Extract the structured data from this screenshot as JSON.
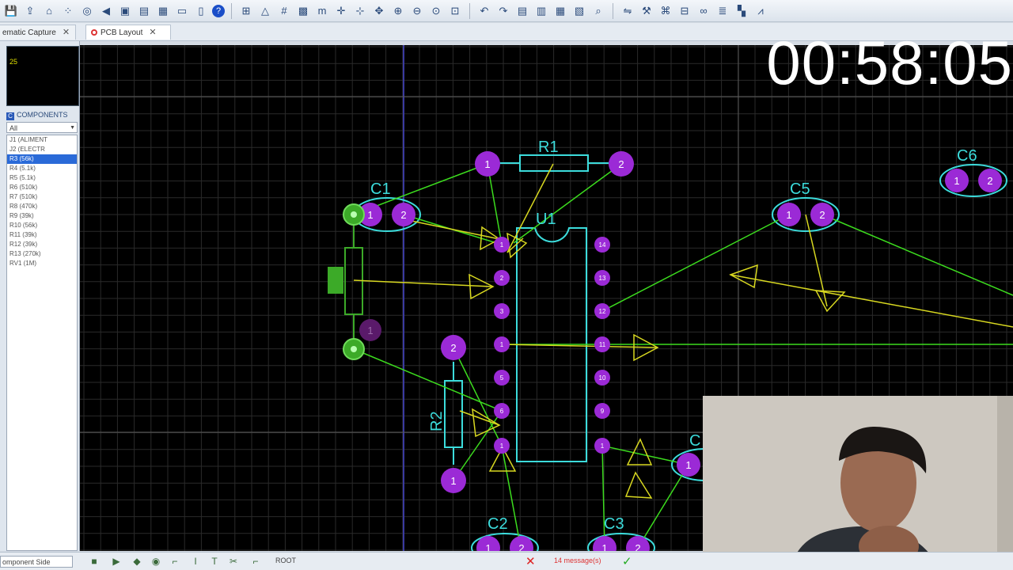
{
  "toolbar": {
    "buttons": [
      "save-icon",
      "export-icon",
      "home-icon",
      "grid-dots-icon",
      "target-icon",
      "back-icon",
      "components-icon",
      "pages-icon",
      "bom-icon",
      "ruler-icon",
      "document-icon",
      "help-icon",
      "library-icon",
      "drc-icon",
      "grid-icon",
      "layers-icon",
      "m-icon",
      "crosshair-icon",
      "origin-icon",
      "pan-icon",
      "zoom-in-icon",
      "zoom-out-icon",
      "zoom-area-icon",
      "zoom-fit-icon",
      "undo-icon",
      "redo-icon",
      "block-copy-icon",
      "block-move-icon",
      "block-rotate-icon",
      "block-delete-icon",
      "search-icon",
      "mirror-icon",
      "tools-icon",
      "autoroute-icon",
      "design-rule-icon",
      "binoculars-icon",
      "layer-stack-icon",
      "color-icon",
      "graph-icon"
    ]
  },
  "tabs": [
    {
      "label": "ematic Capture",
      "active": false
    },
    {
      "label": "PCB Layout",
      "active": true
    }
  ],
  "left_panel": {
    "overview_label": "25",
    "components_header": "COMPONENTS",
    "filter_value": "All",
    "components": [
      {
        "label": "J1    (ALIMENT",
        "selected": false
      },
      {
        "label": "J2    (ELECTR",
        "selected": false
      },
      {
        "label": "R3    (56k)",
        "selected": true
      },
      {
        "label": "R4    (5.1k)",
        "selected": false
      },
      {
        "label": "R5    (5.1k)",
        "selected": false
      },
      {
        "label": "R6    (510k)",
        "selected": false
      },
      {
        "label": "R7    (510k)",
        "selected": false
      },
      {
        "label": "R8    (470k)",
        "selected": false
      },
      {
        "label": "R9    (39k)",
        "selected": false
      },
      {
        "label": "R10   (56k)",
        "selected": false
      },
      {
        "label": "R11   (39k)",
        "selected": false
      },
      {
        "label": "R12   (39k)",
        "selected": false
      },
      {
        "label": "R13   (270k)",
        "selected": false
      },
      {
        "label": "RV1   (1M)",
        "selected": false
      }
    ]
  },
  "pcb": {
    "labels": {
      "r1": "R1",
      "r2": "R2",
      "c1": "C1",
      "c2": "C2",
      "c3": "C3",
      "c5": "C5",
      "c6": "C6",
      "u1": "U1",
      "c4_partial": "C"
    },
    "pins": {
      "one": "1",
      "two": "2",
      "three": "3",
      "five": "5",
      "six": "6",
      "nine": "9",
      "ten": "10",
      "eleven": "11",
      "twelve": "12",
      "thirteen": "13",
      "fourteen": "14"
    },
    "colors": {
      "pad": "#9b2ad6",
      "outline": "#3cdcdc",
      "ratsnest_green": "#3cdc1e",
      "force_vector": "#d8d820",
      "grid": "#2a2a2a",
      "green_pad": "#3caa28"
    }
  },
  "status": {
    "layer_select": "omponent Side",
    "root_label": "ROOT",
    "message": "14 message(s)"
  },
  "overlay": {
    "timer": "00:58:05"
  }
}
